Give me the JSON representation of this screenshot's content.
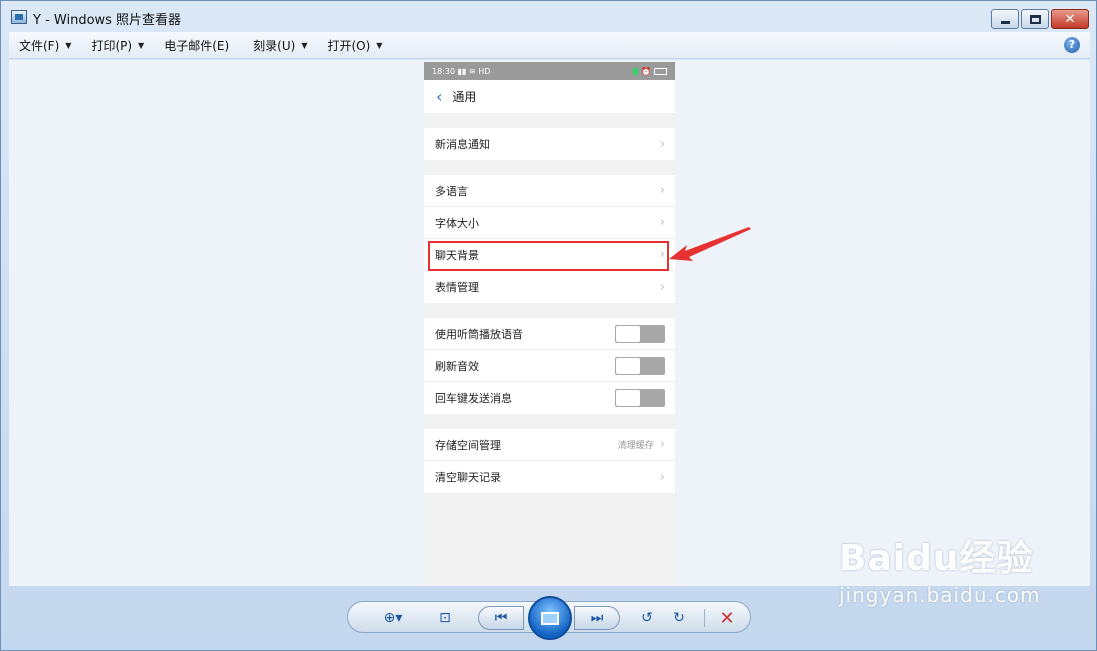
{
  "window": {
    "title": "Y - Windows 照片查看器"
  },
  "menu": {
    "items": [
      {
        "label": "文件(F)"
      },
      {
        "label": "打印(P)"
      },
      {
        "label": "电子邮件(E)"
      },
      {
        "label": "刻录(U)"
      },
      {
        "label": "打开(O)"
      }
    ]
  },
  "phone": {
    "status": {
      "time": "18:30",
      "network": "HD"
    },
    "nav_title": "通用",
    "groups": [
      {
        "rows": [
          {
            "label": "新消息通知"
          }
        ]
      },
      {
        "rows": [
          {
            "label": "多语言"
          },
          {
            "label": "字体大小"
          },
          {
            "label": "聊天背景"
          },
          {
            "label": "表情管理"
          }
        ]
      },
      {
        "rows": [
          {
            "label": "使用听筒播放语音",
            "toggle": false
          },
          {
            "label": "刷新音效",
            "toggle": false
          },
          {
            "label": "回车键发送消息",
            "toggle": false
          }
        ]
      },
      {
        "rows": [
          {
            "label": "存储空间管理",
            "hint": "清理缓存"
          },
          {
            "label": "清空聊天记录"
          }
        ]
      }
    ]
  },
  "annotation": {
    "highlight_color": "#e73030"
  },
  "watermark": {
    "logo": "Baidu经验",
    "url": "jingyan.baidu.com"
  }
}
